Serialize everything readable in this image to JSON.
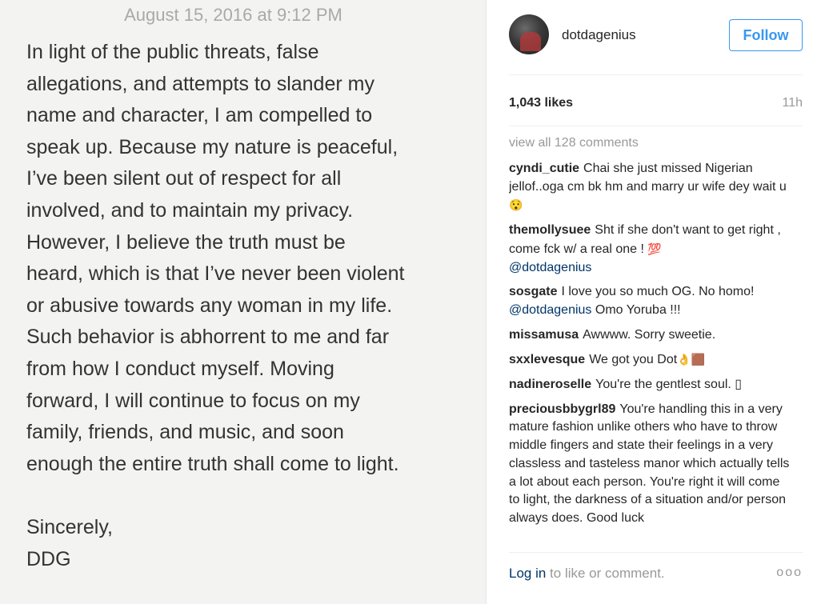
{
  "note": {
    "date": "August 15, 2016 at 9:12 PM",
    "body": "In light of the public threats, false\nallegations, and attempts to slander my\nname and character, I am compelled to\nspeak up.  Because my nature is peaceful,\nI’ve been silent out of respect for all\ninvolved, and to maintain my privacy.\nHowever, I believe the truth must be\nheard, which is that I’ve never been violent\nor abusive towards any woman in my life.\nSuch behavior is abhorrent to me and far\nfrom how I conduct myself.  Moving\nforward, I will continue to focus on my\nfamily, friends, and music, and soon\nenough the entire truth shall come to light.",
    "signoff": "Sincerely,\nDDG"
  },
  "post": {
    "username": "dotdagenius",
    "follow_label": "Follow",
    "likes": "1,043 likes",
    "time_ago": "11h",
    "view_all": "view all 128 comments",
    "comments": [
      {
        "user": "cyndi_cutie",
        "text": "Chai she just missed Nigerian jellof..oga cm bk hm and marry ur wife dey wait u",
        "emoji": "😯"
      },
      {
        "user": "themollysuee",
        "text": "Sht if she don't want to get right , come fck w/ a real one ! ",
        "emoji": "💯",
        "mention": "@dotdagenius"
      },
      {
        "user": "sosgate",
        "text": "I love you so much OG. No homo! ",
        "mention": "@dotdagenius",
        "text_after": " Omo Yoruba !!!"
      },
      {
        "user": "missamusa",
        "text": "Awwww. Sorry sweetie."
      },
      {
        "user": "sxxlevesque",
        "text": "We got you Dot",
        "emoji": "👌🟫"
      },
      {
        "user": "nadineroselle",
        "text": "You're the gentlest soul. ▯"
      },
      {
        "user": "preciousbbygrl89",
        "text": "You're handling this in a very mature fashion unlike others who have to throw middle fingers and state their feelings in a very classless and tasteless manor which actually tells a lot about each person. You're right it will come to light, the darkness of a situation and/or person always does. Good luck"
      }
    ],
    "login_link": "Log in",
    "login_rest": " to like or comment.",
    "more_dots": "ooo"
  }
}
